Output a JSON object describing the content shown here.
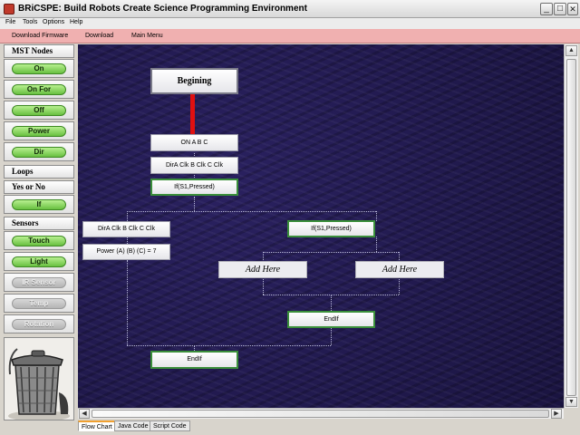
{
  "window": {
    "title": "BRiCSPE: Build Robots Create Science Programming Environment",
    "minimize": "_",
    "maximize": "□",
    "close": "✕"
  },
  "menubar": [
    "File",
    "Tools",
    "Options",
    "Help"
  ],
  "toolbar": [
    "Download Firmware",
    "Download",
    "Main Menu"
  ],
  "palette": {
    "mst_nodes": "MST Nodes",
    "loops": "Loops",
    "yes_or_no": "Yes or No",
    "sensors": "Sensors",
    "buttons": {
      "on": "On",
      "on_for": "On For",
      "off": "Off",
      "power": "Power",
      "dir": "Dir",
      "if": "If",
      "touch": "Touch",
      "light": "Light",
      "ir_sensor": "IR Sensor",
      "temp": "Temp",
      "rotation": "Rotation"
    }
  },
  "flow": {
    "begin": "Begining",
    "on": "ON  A B C",
    "dir1": "DirA Clk B Clk C Clk",
    "if1": "If(S1,Pressed)",
    "dir2": "DirA Clk B Clk C Clk",
    "power": "Power (A)  (B)  (C) = 7",
    "if2": "If(S1,Pressed)",
    "add_here_1": "Add Here",
    "add_here_2": "Add Here",
    "endif_inner": "EndIf",
    "endif_outer": "EndIf"
  },
  "tabs": [
    "Flow Chart",
    "Java Code",
    "Script Code"
  ],
  "colors": {
    "toolbar": "#f0b0b0",
    "canvas": "#1f1848",
    "start_line": "#e01010",
    "node_border_green": "#3b8f3b",
    "button_green": "#68c040"
  },
  "icons": {
    "trash": "trash-can-icon",
    "app": "app-icon"
  }
}
